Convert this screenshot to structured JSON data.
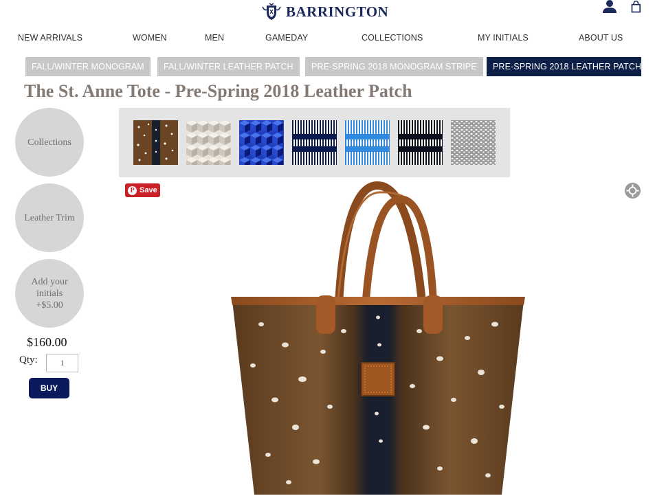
{
  "brand": {
    "name": "BARRINGTON"
  },
  "header": {
    "account_icon": "user-icon",
    "cart_icon": "shopping-bag-icon"
  },
  "nav": {
    "items": [
      {
        "label": "NEW ARRIVALS"
      },
      {
        "label": "WOMEN"
      },
      {
        "label": "MEN"
      },
      {
        "label": "GAMEDAY"
      },
      {
        "label": "COLLECTIONS"
      },
      {
        "label": "MY INITIALS"
      },
      {
        "label": "ABOUT US"
      }
    ]
  },
  "tabs": [
    {
      "label": "FALL/WINTER MONOGRAM",
      "active": false
    },
    {
      "label": "FALL/WINTER LEATHER PATCH",
      "active": false
    },
    {
      "label": "PRE-SPRING 2018 MONOGRAM STRIPE",
      "active": false
    },
    {
      "label": "PRE-SPRING 2018 LEATHER PATCH",
      "active": true
    }
  ],
  "product": {
    "title": "The St. Anne Tote - Pre-Spring 2018 Leather Patch",
    "price": "$160.00",
    "qty_label": "Qty:",
    "qty_value": "1",
    "buy_label": "BUY"
  },
  "options": [
    {
      "line1": "Collections"
    },
    {
      "line1": "Leather Trim"
    },
    {
      "line1": "Add your",
      "line2": "initials",
      "line3": "+$5.00"
    }
  ],
  "swatches": [
    {
      "name": "axis-deer-swatch",
      "colors": [
        "#6b4423",
        "#1a1f2e",
        "#ffffff"
      ]
    },
    {
      "name": "cream-cube-swatch",
      "colors": [
        "#e8e4dc",
        "#cfc9bd",
        "#b8b2a6"
      ]
    },
    {
      "name": "blue-cube-swatch",
      "colors": [
        "#1f3fbf",
        "#3a63e8",
        "#0a1a7a"
      ]
    },
    {
      "name": "navy-stripe-swatch",
      "colors": [
        "#0b1a4d",
        "#ffffff"
      ]
    },
    {
      "name": "blue-stripe-swatch",
      "colors": [
        "#2f8ae0",
        "#ffffff"
      ]
    },
    {
      "name": "black-stripe-swatch",
      "colors": [
        "#0b0f1c",
        "#ffffff"
      ]
    },
    {
      "name": "grey-dot-swatch",
      "colors": [
        "#9a9a9a",
        "#ffffff"
      ]
    }
  ],
  "social": {
    "save_label": "Save",
    "pin_glyph": "P"
  },
  "colors": {
    "navy": "#0e1f48",
    "tab_grey": "#c7c7c7",
    "pinterest_red": "#cb2027"
  }
}
